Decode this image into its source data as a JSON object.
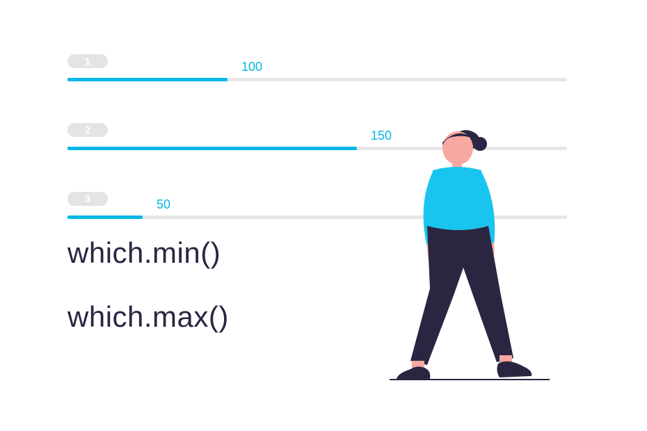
{
  "bars": [
    {
      "index": "1",
      "value_label": "100",
      "fill_percent": 32
    },
    {
      "index": "2",
      "value_label": "150",
      "fill_percent": 58
    },
    {
      "index": "3",
      "value_label": "50",
      "fill_percent": 15
    }
  ],
  "functions": {
    "min": "which.min()",
    "max": "which.max()"
  },
  "colors": {
    "accent": "#00b8e6",
    "text_dark": "#2a2642",
    "badge_bg": "#e4e4e4",
    "skin": "#f7a8a0",
    "hair": "#2a2642",
    "shirt": "#19c5ef",
    "pants": "#2a2642",
    "shoes": "#2a2642"
  },
  "chart_data": {
    "type": "bar",
    "categories": [
      "1",
      "2",
      "3"
    ],
    "values": [
      100,
      150,
      50
    ],
    "title": "",
    "xlabel": "",
    "ylabel": "",
    "ylim": [
      0,
      260
    ]
  }
}
